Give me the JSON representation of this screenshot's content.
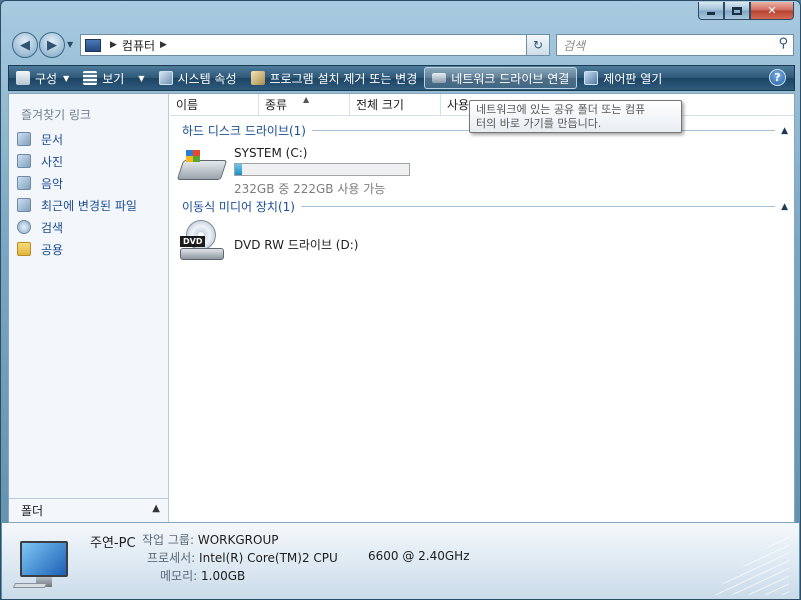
{
  "address": {
    "path_segment": "컴퓨터",
    "search_placeholder": "검색"
  },
  "toolbar": {
    "organize": "구성",
    "views": "보기",
    "system_properties": "시스템 속성",
    "uninstall": "프로그램 설치 제거 또는 변경",
    "map_drive": "네트워크 드라이브 연결",
    "control_panel": "제어판 열기",
    "help": "?"
  },
  "sidebar": {
    "heading": "즐겨찾기 링크",
    "items": [
      {
        "label": "문서",
        "icon": "documents-icon"
      },
      {
        "label": "사진",
        "icon": "pictures-icon"
      },
      {
        "label": "음악",
        "icon": "music-icon"
      },
      {
        "label": "최근에 변경된 파일",
        "icon": "recent-files-icon"
      },
      {
        "label": "검색",
        "icon": "search-icon"
      },
      {
        "label": "공용",
        "icon": "folder-icon"
      }
    ],
    "folders_label": "폴더"
  },
  "columns": [
    "이름",
    "종류",
    "전체 크기",
    "사용"
  ],
  "groups": {
    "hard_disks": "하드 디스크 드라이브(1)",
    "removable": "이동식 미디어 장치(1)"
  },
  "drives": {
    "c": {
      "name": "SYSTEM (C:)",
      "free_text": "232GB 중 222GB 사용 가능",
      "used_fraction": 0.043
    },
    "d": {
      "name": "DVD RW 드라이브 (D:)",
      "icon_label": "DVD"
    }
  },
  "tooltip": {
    "line1": "네트워크에 있는 공유 폴더 또는 컴퓨",
    "line2": "터의 바로 가기를 만듭니다."
  },
  "details": {
    "computer_name": "주연-PC",
    "workgroup_label": "작업 그룹:",
    "workgroup_value": "WORKGROUP",
    "processor_label": "프로세서:",
    "processor_value": "Intel(R) Core(TM)2 CPU",
    "processor_speed": "6600  @ 2.40GHz",
    "memory_label": "메모리:",
    "memory_value": "1.00GB"
  }
}
